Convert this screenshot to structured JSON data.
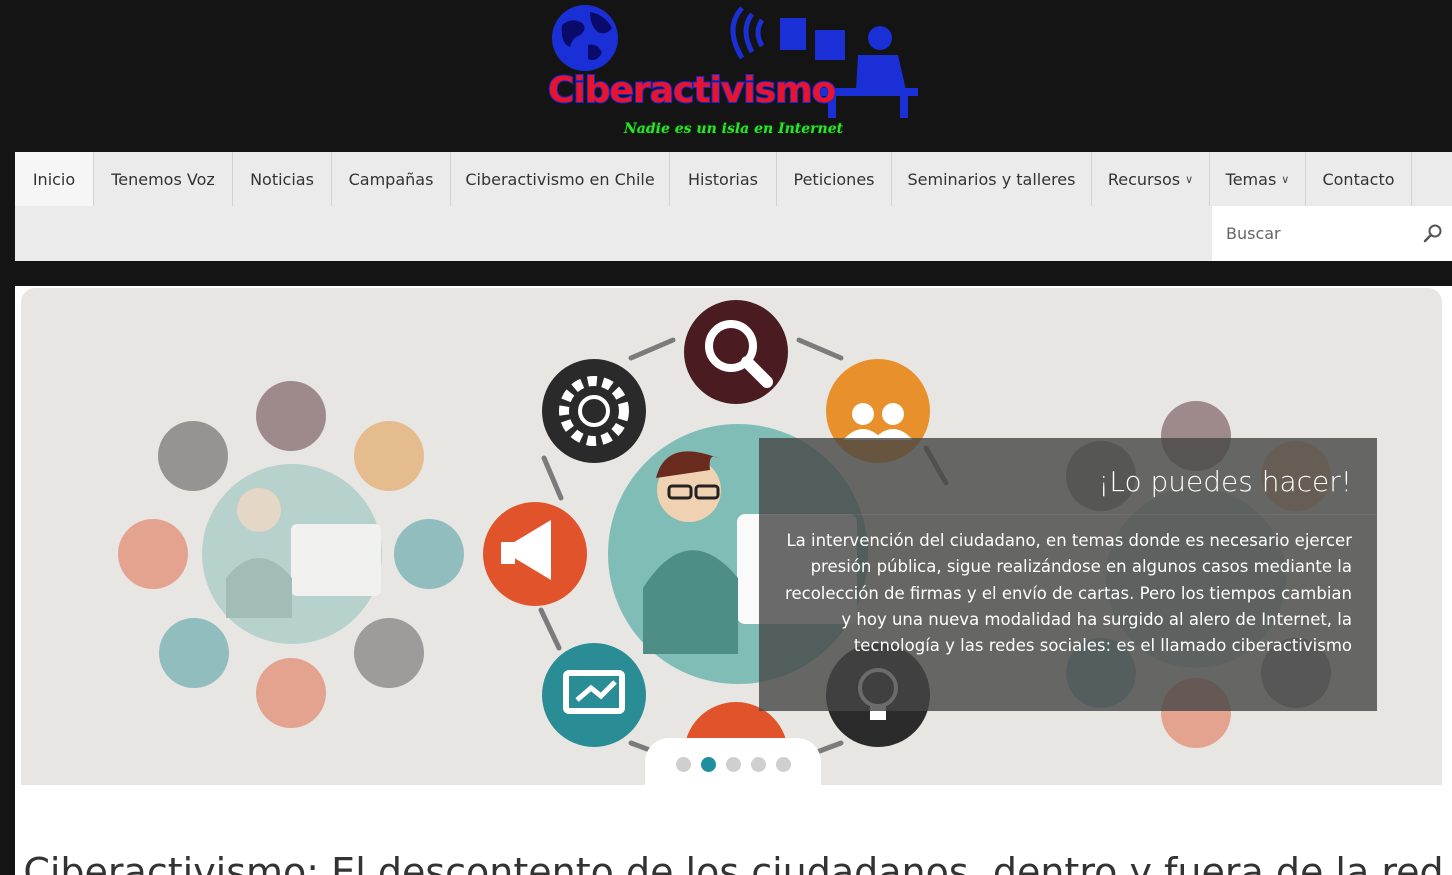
{
  "logo": {
    "title": "Ciberactivismo",
    "tagline": "Nadie es un isla en Internet"
  },
  "nav": {
    "items": [
      {
        "label": "Inicio",
        "active": true
      },
      {
        "label": "Tenemos Voz"
      },
      {
        "label": "Noticias"
      },
      {
        "label": "Campañas"
      },
      {
        "label": "Ciberactivismo en Chile"
      },
      {
        "label": "Historias"
      },
      {
        "label": "Peticiones"
      },
      {
        "label": "Seminarios y talleres"
      },
      {
        "label": "Recursos",
        "dropdown": true
      },
      {
        "label": "Temas",
        "dropdown": true
      },
      {
        "label": "Contacto"
      }
    ],
    "search_placeholder": "Buscar"
  },
  "slider": {
    "caption_title": "¡Lo puedes hacer!",
    "caption_body": "La intervención del ciudadano, en temas donde es necesario ejercer presión pública, sigue realizándose en algunos casos mediante la recolección de firmas y el envío de cartas. Pero los tiempos cambian y hoy una nueva modalidad ha surgido al alero de Internet, la tecnología y las redes sociales: es el llamado ciberactivismo",
    "slide_count": 5,
    "active_slide": 2
  },
  "headline": "Ciberactivismo: El descontento de los ciudadanos, dentro y fuera de la red",
  "colors": {
    "header_bg": "#141414",
    "nav_bg": "#ebebeb",
    "logo_red": "#e8142e",
    "logo_blue": "#1626d8",
    "tagline_green": "#2fe02f",
    "dot_active": "#1f8fa0"
  }
}
